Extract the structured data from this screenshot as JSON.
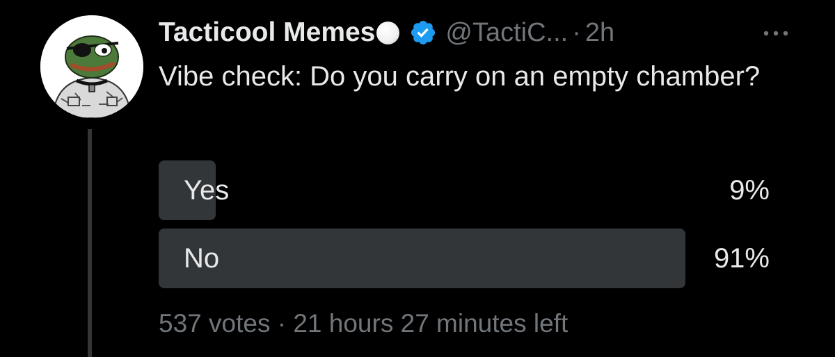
{
  "author": {
    "display_name": "Tacticool Memes",
    "name_emoji": "moon-emoji",
    "verified": true,
    "verified_color": "#1d9bf0",
    "handle": "@TactiC...",
    "separator": "·",
    "time": "2h"
  },
  "icons": {
    "avatar": "pepe-avatar",
    "verified": "verified-badge-icon",
    "more": "more-options-icon"
  },
  "tweet": {
    "text": "Vibe check: Do you carry on an empty chamber?"
  },
  "poll": {
    "options": [
      {
        "label": "Yes",
        "percent_label": "9%",
        "percent": 9
      },
      {
        "label": "No",
        "percent_label": "91%",
        "percent": 91
      }
    ],
    "votes": "537 votes",
    "separator": "·",
    "time_left": "21 hours 27 minutes left"
  },
  "colors": {
    "background": "#000000",
    "text_primary": "#e7e9ea",
    "text_secondary": "#71767b",
    "poll_fill": "#333639"
  }
}
